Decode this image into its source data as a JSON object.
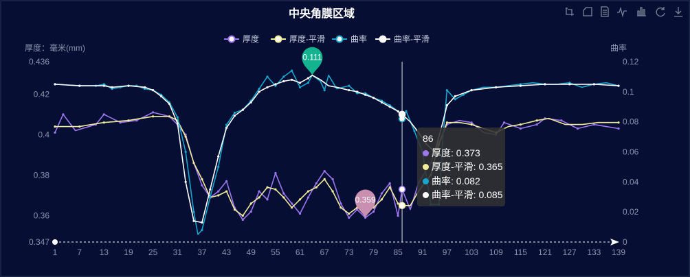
{
  "title": "中央角膜区域",
  "toolbox": {
    "icons": [
      "zoom-select-icon",
      "zoom-reset-icon",
      "data-view-icon",
      "line-chart-icon",
      "bar-chart-icon",
      "restore-icon",
      "save-image-icon"
    ]
  },
  "legend": [
    {
      "name": "厚度",
      "color": "#9d76f0"
    },
    {
      "name": "厚度-平滑",
      "color": "#f2ec9b"
    },
    {
      "name": "曲率",
      "color": "#17a6cd"
    },
    {
      "name": "曲率-平滑",
      "color": "#ffffff"
    }
  ],
  "tooltip": {
    "header": "86",
    "rows": [
      {
        "label": "厚度: 0.373",
        "color": "#9d76f0"
      },
      {
        "label": "厚度-平滑: 0.365",
        "color": "#f2ec9b"
      },
      {
        "label": "曲率: 0.082",
        "color": "#17a6cd"
      },
      {
        "label": "曲率-平滑: 0.085",
        "color": "#ffffff"
      }
    ]
  },
  "chart_data": {
    "type": "line",
    "title": "中央角膜区域",
    "x_label": "",
    "x_categories_start": 1,
    "x_categories_end": 139,
    "x_tick_labels": [
      "1",
      "7",
      "13",
      "19",
      "25",
      "31",
      "37",
      "43",
      "49",
      "55",
      "61",
      "67",
      "73",
      "79",
      "85",
      "91",
      "97",
      "103",
      "109",
      "115",
      "121",
      "127",
      "133",
      "139"
    ],
    "y_left": {
      "name": "厚度：毫米(mm)",
      "min": 0.347,
      "max": 0.436,
      "ticks": [
        "0.347",
        "0.36",
        "0.38",
        "0.4",
        "0.42",
        "0.436"
      ]
    },
    "y_right": {
      "name": "曲率",
      "min": 0,
      "max": 0.12,
      "ticks": [
        "0",
        "0.02",
        "0.04",
        "0.06",
        "0.08",
        "0.1",
        "0.12"
      ]
    },
    "markers": [
      {
        "label": "0.111",
        "series": "曲率",
        "x": 64,
        "value": 0.111,
        "color": "#13b38f"
      },
      {
        "label": "0.359",
        "series": "厚度",
        "x": 77,
        "value": 0.359,
        "color": "#c98fb0"
      }
    ],
    "cursor_x": 86,
    "series": [
      {
        "name": "厚度",
        "axis": "left",
        "color": "#9d76f0",
        "keypoints": [
          [
            1,
            0.401
          ],
          [
            3,
            0.41
          ],
          [
            6,
            0.402
          ],
          [
            11,
            0.405
          ],
          [
            13,
            0.41
          ],
          [
            17,
            0.406
          ],
          [
            21,
            0.407
          ],
          [
            25,
            0.411
          ],
          [
            29,
            0.409
          ],
          [
            31,
            0.405
          ],
          [
            33,
            0.4
          ],
          [
            35,
            0.386
          ],
          [
            37,
            0.375
          ],
          [
            39,
            0.369
          ],
          [
            41,
            0.372
          ],
          [
            43,
            0.377
          ],
          [
            45,
            0.364
          ],
          [
            47,
            0.358
          ],
          [
            49,
            0.362
          ],
          [
            51,
            0.372
          ],
          [
            53,
            0.368
          ],
          [
            55,
            0.381
          ],
          [
            57,
            0.371
          ],
          [
            59,
            0.366
          ],
          [
            61,
            0.361
          ],
          [
            63,
            0.369
          ],
          [
            65,
            0.376
          ],
          [
            67,
            0.382
          ],
          [
            69,
            0.378
          ],
          [
            71,
            0.366
          ],
          [
            73,
            0.359
          ],
          [
            75,
            0.363
          ],
          [
            77,
            0.359
          ],
          [
            79,
            0.362
          ],
          [
            81,
            0.371
          ],
          [
            83,
            0.376
          ],
          [
            85,
            0.36
          ],
          [
            86,
            0.373
          ],
          [
            88,
            0.363
          ],
          [
            90,
            0.376
          ],
          [
            93,
            0.386
          ],
          [
            95,
            0.396
          ],
          [
            97,
            0.405
          ],
          [
            100,
            0.407
          ],
          [
            103,
            0.406
          ],
          [
            106,
            0.401
          ],
          [
            109,
            0.4
          ],
          [
            111,
            0.406
          ],
          [
            115,
            0.403
          ],
          [
            119,
            0.405
          ],
          [
            121,
            0.408
          ],
          [
            125,
            0.407
          ],
          [
            129,
            0.403
          ],
          [
            133,
            0.405
          ],
          [
            136,
            0.404
          ],
          [
            139,
            0.403
          ]
        ]
      },
      {
        "name": "厚度-平滑",
        "axis": "left",
        "color": "#f2ec9b",
        "keypoints": [
          [
            1,
            0.404
          ],
          [
            7,
            0.404
          ],
          [
            13,
            0.406
          ],
          [
            19,
            0.407
          ],
          [
            25,
            0.409
          ],
          [
            29,
            0.409
          ],
          [
            31,
            0.407
          ],
          [
            33,
            0.399
          ],
          [
            35,
            0.386
          ],
          [
            37,
            0.378
          ],
          [
            39,
            0.369
          ],
          [
            41,
            0.37
          ],
          [
            43,
            0.372
          ],
          [
            45,
            0.363
          ],
          [
            47,
            0.36
          ],
          [
            49,
            0.366
          ],
          [
            51,
            0.369
          ],
          [
            53,
            0.374
          ],
          [
            55,
            0.373
          ],
          [
            57,
            0.369
          ],
          [
            59,
            0.364
          ],
          [
            61,
            0.368
          ],
          [
            63,
            0.372
          ],
          [
            65,
            0.374
          ],
          [
            67,
            0.378
          ],
          [
            69,
            0.372
          ],
          [
            71,
            0.364
          ],
          [
            73,
            0.361
          ],
          [
            75,
            0.364
          ],
          [
            77,
            0.366
          ],
          [
            79,
            0.364
          ],
          [
            81,
            0.368
          ],
          [
            83,
            0.374
          ],
          [
            85,
            0.366
          ],
          [
            86,
            0.365
          ],
          [
            88,
            0.365
          ],
          [
            90,
            0.372
          ],
          [
            93,
            0.38
          ],
          [
            95,
            0.395
          ],
          [
            97,
            0.406
          ],
          [
            100,
            0.406
          ],
          [
            103,
            0.405
          ],
          [
            106,
            0.403
          ],
          [
            109,
            0.401
          ],
          [
            112,
            0.404
          ],
          [
            115,
            0.405
          ],
          [
            119,
            0.407
          ],
          [
            122,
            0.408
          ],
          [
            126,
            0.405
          ],
          [
            130,
            0.405
          ],
          [
            134,
            0.406
          ],
          [
            139,
            0.406
          ]
        ]
      },
      {
        "name": "曲率",
        "axis": "right",
        "color": "#17a6cd",
        "keypoints": [
          [
            1,
            0.105
          ],
          [
            7,
            0.104
          ],
          [
            11,
            0.104
          ],
          [
            13,
            0.105
          ],
          [
            15,
            0.102
          ],
          [
            17,
            0.103
          ],
          [
            19,
            0.104
          ],
          [
            21,
            0.104
          ],
          [
            23,
            0.102
          ],
          [
            25,
            0.101
          ],
          [
            27,
            0.098
          ],
          [
            29,
            0.093
          ],
          [
            31,
            0.083
          ],
          [
            33,
            0.06
          ],
          [
            35,
            0.02
          ],
          [
            36,
            0.005
          ],
          [
            37,
            0.008
          ],
          [
            39,
            0.03
          ],
          [
            41,
            0.05
          ],
          [
            43,
            0.078
          ],
          [
            45,
            0.086
          ],
          [
            47,
            0.088
          ],
          [
            49,
            0.094
          ],
          [
            51,
            0.102
          ],
          [
            53,
            0.11
          ],
          [
            55,
            0.104
          ],
          [
            57,
            0.11
          ],
          [
            59,
            0.114
          ],
          [
            61,
            0.103
          ],
          [
            63,
            0.106
          ],
          [
            64,
            0.111
          ],
          [
            66,
            0.107
          ],
          [
            67,
            0.101
          ],
          [
            68,
            0.111
          ],
          [
            70,
            0.102
          ],
          [
            73,
            0.104
          ],
          [
            75,
            0.099
          ],
          [
            77,
            0.099
          ],
          [
            79,
            0.096
          ],
          [
            81,
            0.094
          ],
          [
            83,
            0.091
          ],
          [
            85,
            0.087
          ],
          [
            86,
            0.082
          ],
          [
            87,
            0.087
          ],
          [
            89,
            0.074
          ],
          [
            91,
            0.06
          ],
          [
            93,
            0.025
          ],
          [
            95,
            0.025
          ],
          [
            96,
            0.07
          ],
          [
            97,
            0.101
          ],
          [
            99,
            0.095
          ],
          [
            101,
            0.098
          ],
          [
            103,
            0.101
          ],
          [
            106,
            0.103
          ],
          [
            109,
            0.103
          ],
          [
            112,
            0.104
          ],
          [
            115,
            0.105
          ],
          [
            118,
            0.106
          ],
          [
            121,
            0.105
          ],
          [
            124,
            0.105
          ],
          [
            127,
            0.106
          ],
          [
            130,
            0.103
          ],
          [
            133,
            0.105
          ],
          [
            136,
            0.106
          ],
          [
            139,
            0.104
          ]
        ]
      },
      {
        "name": "曲率-平滑",
        "axis": "right",
        "color": "#ffffff",
        "keypoints": [
          [
            1,
            0.105
          ],
          [
            7,
            0.104
          ],
          [
            13,
            0.104
          ],
          [
            15,
            0.103
          ],
          [
            19,
            0.104
          ],
          [
            23,
            0.103
          ],
          [
            25,
            0.101
          ],
          [
            27,
            0.097
          ],
          [
            29,
            0.092
          ],
          [
            31,
            0.079
          ],
          [
            33,
            0.04
          ],
          [
            35,
            0.014
          ],
          [
            37,
            0.013
          ],
          [
            39,
            0.035
          ],
          [
            41,
            0.057
          ],
          [
            43,
            0.076
          ],
          [
            45,
            0.084
          ],
          [
            47,
            0.088
          ],
          [
            49,
            0.093
          ],
          [
            51,
            0.1
          ],
          [
            53,
            0.103
          ],
          [
            55,
            0.105
          ],
          [
            57,
            0.107
          ],
          [
            59,
            0.108
          ],
          [
            61,
            0.106
          ],
          [
            63,
            0.109
          ],
          [
            64,
            0.111
          ],
          [
            66,
            0.108
          ],
          [
            68,
            0.104
          ],
          [
            70,
            0.103
          ],
          [
            73,
            0.101
          ],
          [
            75,
            0.1
          ],
          [
            77,
            0.098
          ],
          [
            79,
            0.096
          ],
          [
            81,
            0.093
          ],
          [
            83,
            0.09
          ],
          [
            85,
            0.087
          ],
          [
            86,
            0.085
          ],
          [
            88,
            0.08
          ],
          [
            90,
            0.073
          ],
          [
            92,
            0.065
          ],
          [
            94,
            0.06
          ],
          [
            96,
            0.08
          ],
          [
            97,
            0.091
          ],
          [
            99,
            0.097
          ],
          [
            103,
            0.101
          ],
          [
            109,
            0.103
          ],
          [
            115,
            0.104
          ],
          [
            121,
            0.105
          ],
          [
            127,
            0.105
          ],
          [
            133,
            0.105
          ],
          [
            139,
            0.104
          ]
        ]
      }
    ]
  }
}
